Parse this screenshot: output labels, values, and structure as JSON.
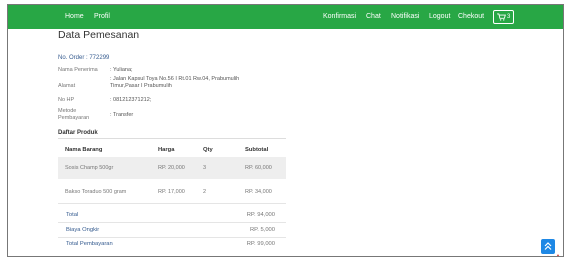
{
  "nav": {
    "items": [
      "Home",
      "Profil"
    ],
    "right_items": [
      "Konfirmasi",
      "Chat",
      "Notifikasi",
      "Logout",
      "Chekout"
    ],
    "cart_count": "3",
    "color": "#28a745"
  },
  "page": {
    "title": "Data Pemesanan",
    "order_label": "No. Order : 772299"
  },
  "info": [
    {
      "label": "Nama Penerima",
      "value": ": Yuliana;"
    },
    {
      "label": "Alamat",
      "value": ": Jalan Kapsul Toya No.56 I Rt.01 Rw.04, Prabumulih Timur,Pasar I Prabumulih"
    },
    {
      "label": "No HP",
      "value": ": 081212371212;"
    },
    {
      "label": "Metode Pembayaran",
      "value": ": Transfer"
    }
  ],
  "products": {
    "title": "Daftar Produk",
    "headers": [
      "Nama Barang",
      "Harga",
      "Qty",
      "Subtotal"
    ],
    "rows": [
      [
        "Sosis Champ 500gr",
        "RP. 20,000",
        "3",
        "RP. 60,000"
      ],
      [
        "Bakso Toraduo 500 gram",
        "RP. 17,000",
        "2",
        "RP. 34,000"
      ]
    ]
  },
  "summary": [
    {
      "label": "Total",
      "value": "RP. 94,000"
    },
    {
      "label": "Biaya Ongkir",
      "value": "RP. 5,000"
    },
    {
      "label": "Total Pembayaran",
      "value": "RP. 99,000"
    }
  ],
  "icons": {
    "cart": "cart-icon",
    "scroll_top": "chevron-up-icon"
  },
  "colors": {
    "accent": "#28a745",
    "button_blue": "#1e88e5",
    "text_blue": "#355b8f"
  }
}
